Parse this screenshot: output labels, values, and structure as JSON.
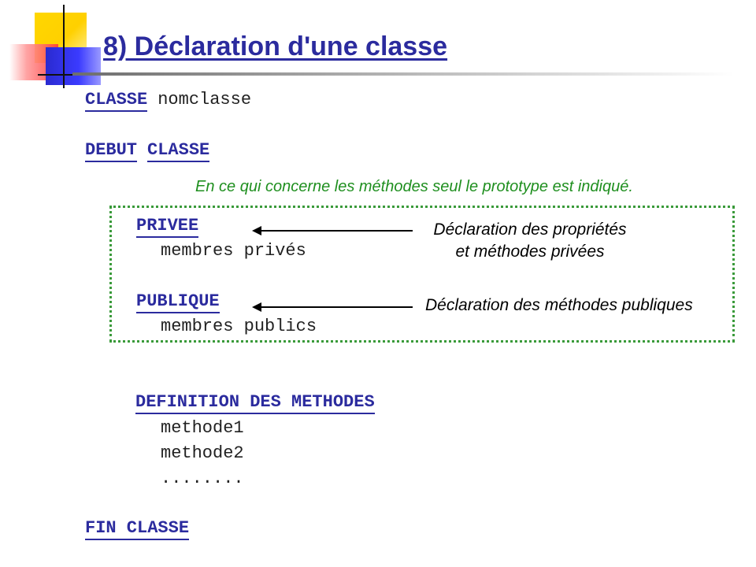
{
  "title": "8) Déclaration d'une classe",
  "line_classe": {
    "kw": "CLASSE",
    "text": "nomclasse"
  },
  "line_debut": {
    "kw1": "DEBUT",
    "kw2": "CLASSE"
  },
  "note_prototype": "En ce qui concerne les méthodes seul le prototype est indiqué.",
  "privee": {
    "kw": "PRIVEE",
    "text": "membres privés",
    "annotation_line1": "Déclaration des propriétés",
    "annotation_line2": "et méthodes privées"
  },
  "publique": {
    "kw": "PUBLIQUE",
    "text": "membres publics",
    "annotation": "Déclaration des méthodes publiques"
  },
  "definition": {
    "kw": "DEFINITION DES METHODES",
    "items": [
      "methode1",
      "methode2",
      "........"
    ]
  },
  "fin": {
    "kw": "FIN CLASSE"
  },
  "colors": {
    "keyword": "#2b2b9e",
    "note": "#1f8f1f",
    "box_border": "#3a9a3a"
  }
}
